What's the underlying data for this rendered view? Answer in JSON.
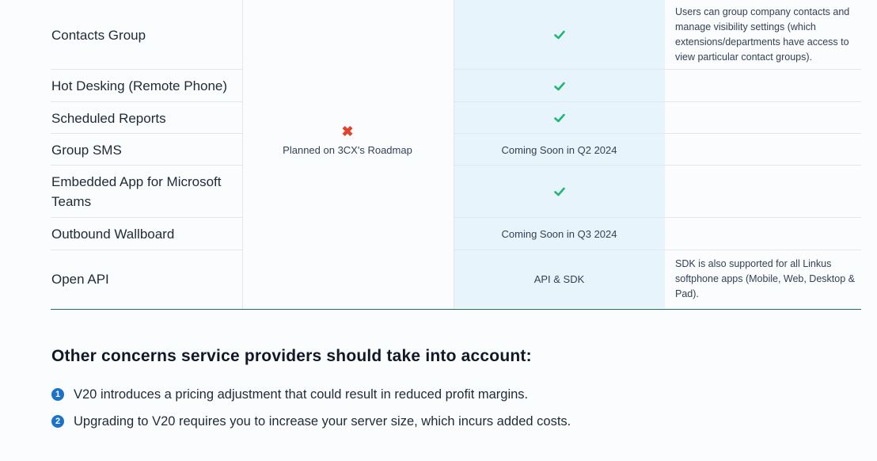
{
  "table": {
    "rows": [
      {
        "feature": "Contacts Group",
        "value": "check",
        "note": "Users can group company contacts and manage visibility settings (which extensions/departments have access to view particular contact groups)."
      },
      {
        "feature": "Hot Desking (Remote Phone)",
        "value": "check",
        "note": ""
      },
      {
        "feature": "Scheduled Reports",
        "value": "check",
        "note": ""
      },
      {
        "feature": "Group SMS",
        "value": "Coming Soon in Q2 2024",
        "note": ""
      },
      {
        "feature": "Embedded App for Microsoft Teams",
        "value": "check",
        "note": ""
      },
      {
        "feature": "Outbound Wallboard",
        "value": "Coming Soon in Q3 2024",
        "note": ""
      },
      {
        "feature": "Open API",
        "value": "API & SDK",
        "note": "SDK is also supported for all Linkus softphone apps (Mobile, Web, Desktop & Pad)."
      }
    ],
    "middle_column": {
      "icon": "cross-icon",
      "text": "Planned on 3CX's Roadmap"
    }
  },
  "section": {
    "title": "Other concerns service providers should take into account:",
    "items": [
      {
        "number": "1",
        "text": "V20 introduces a pricing adjustment that could result in reduced profit margins."
      },
      {
        "number": "2",
        "text": "Upgrading to V20 requires you to increase your server size, which incurs added costs."
      }
    ]
  },
  "colors": {
    "check": "#22b573",
    "cross": "#e0442f",
    "accent": "#1a73c9",
    "shade": "#e8f4fb"
  }
}
